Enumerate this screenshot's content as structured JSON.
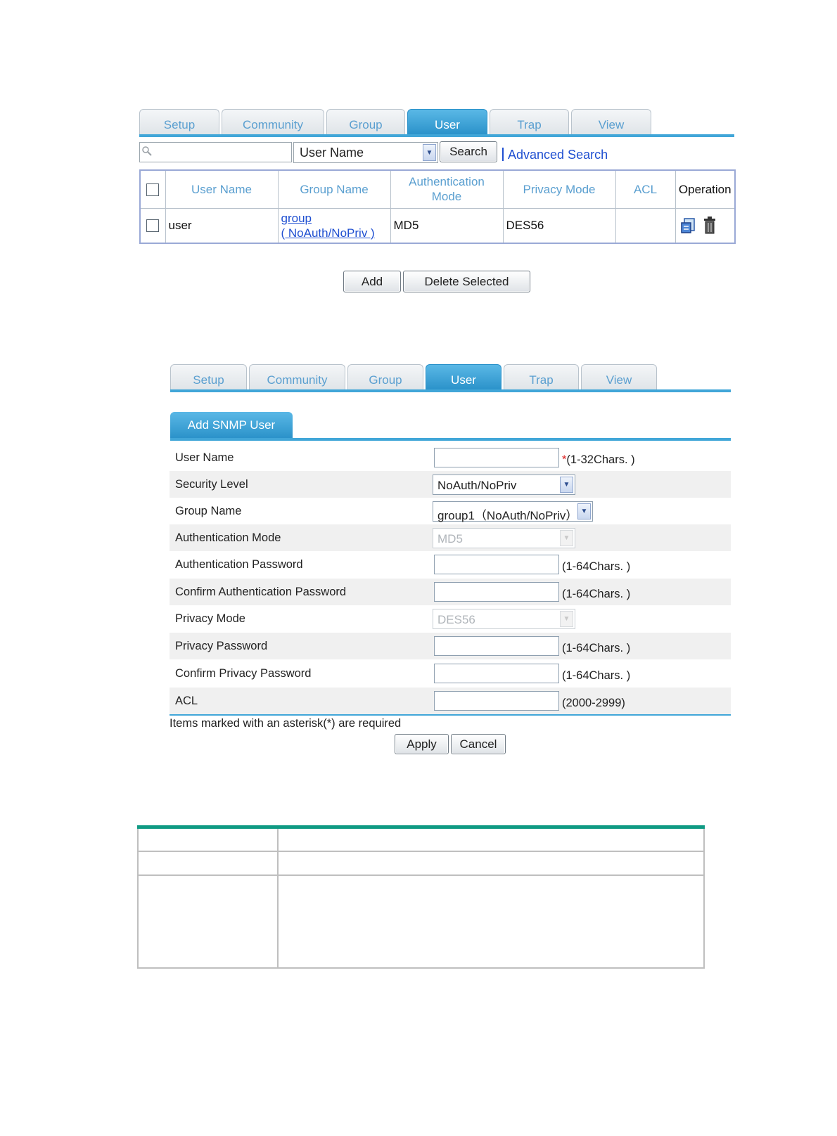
{
  "list_view": {
    "tabs": [
      "Setup",
      "Community",
      "Group",
      "User",
      "Trap",
      "View"
    ],
    "active_tab": "User",
    "search": {
      "placeholder": "",
      "field_select": "User Name",
      "search_button": "Search",
      "advanced_link": "Advanced Search"
    },
    "table": {
      "headers": [
        "User Name",
        "Group Name",
        "Authentication Mode",
        "Privacy Mode",
        "ACL",
        "Operation"
      ],
      "rows": [
        {
          "user_name": "user",
          "group_name_line1": "group",
          "group_name_line2": "( NoAuth/NoPriv )",
          "auth_mode": "MD5",
          "privacy_mode": "DES56",
          "acl": "",
          "operations": [
            "edit-icon",
            "delete-icon"
          ]
        }
      ]
    },
    "buttons": {
      "add": "Add",
      "delete_selected": "Delete Selected"
    }
  },
  "add_view": {
    "tabs": [
      "Setup",
      "Community",
      "Group",
      "User",
      "Trap",
      "View"
    ],
    "active_tab": "User",
    "panel_title": "Add SNMP User",
    "fields": {
      "user_name": {
        "label": "User Name",
        "value": "",
        "required_mark": "*",
        "hint": "(1-32Chars. )"
      },
      "security_level": {
        "label": "Security Level",
        "value": "NoAuth/NoPriv"
      },
      "group_name": {
        "label": "Group Name",
        "value": "group1（NoAuth/NoPriv）"
      },
      "auth_mode": {
        "label": "Authentication Mode",
        "value": "MD5"
      },
      "auth_password": {
        "label": "Authentication Password",
        "value": "",
        "hint": "(1-64Chars. )"
      },
      "confirm_auth_password": {
        "label": "Confirm Authentication Password",
        "value": "",
        "hint": "(1-64Chars. )"
      },
      "privacy_mode": {
        "label": "Privacy Mode",
        "value": "DES56"
      },
      "privacy_password": {
        "label": "Privacy Password",
        "value": "",
        "hint": "(1-64Chars. )"
      },
      "confirm_privacy_password": {
        "label": "Confirm Privacy Password",
        "value": "",
        "hint": "(1-64Chars. )"
      },
      "acl": {
        "label": "ACL",
        "value": "",
        "hint": "(2000-2999)"
      }
    },
    "note": "Items marked with an asterisk(*) are required",
    "buttons": {
      "apply": "Apply",
      "cancel": "Cancel"
    }
  },
  "colors": {
    "tab_active": "#2a91c9",
    "tab_text": "#5a9fd0",
    "link": "#1f4fd1",
    "table_accent": "#0f9a83"
  }
}
